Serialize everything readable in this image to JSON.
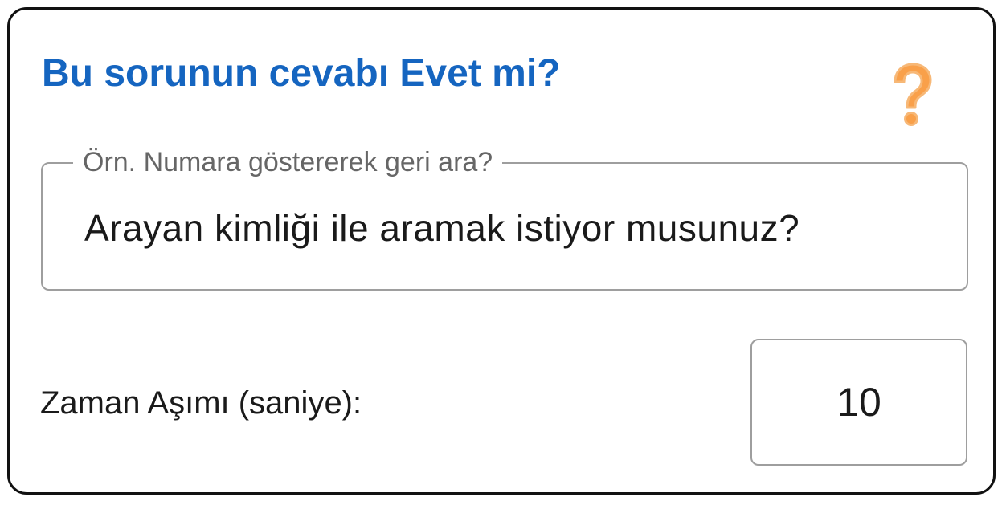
{
  "dialog": {
    "title": "Bu sorunun cevabı Evet mi?",
    "help_icon": "question-mark-icon",
    "accent_color": "#1565c0",
    "icon_color": "#f9a04a"
  },
  "question_field": {
    "label": "Örn. Numara göstererek geri ara?",
    "value": "Arayan kimliği ile aramak istiyor musunuz?"
  },
  "timeout": {
    "label": "Zaman Aşımı (saniye):",
    "value": "10"
  }
}
